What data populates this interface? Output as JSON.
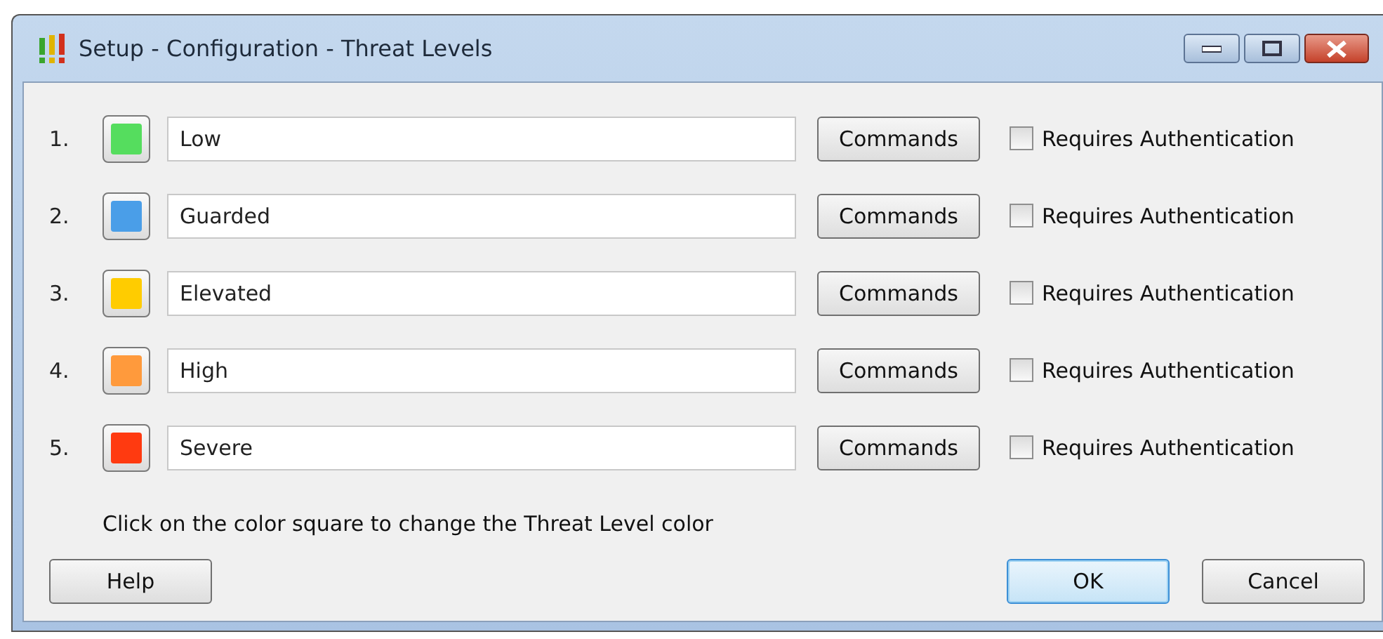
{
  "window": {
    "title": "Setup - Configuration - Threat Levels"
  },
  "levels": [
    {
      "number": "1.",
      "color": "#55dd5e",
      "name": "Low",
      "button": "Commands",
      "auth_label": "Requires Authentication",
      "requires_auth": false
    },
    {
      "number": "2.",
      "color": "#4a9ee8",
      "name": "Guarded",
      "button": "Commands",
      "auth_label": "Requires Authentication",
      "requires_auth": false
    },
    {
      "number": "3.",
      "color": "#ffcc00",
      "name": "Elevated",
      "button": "Commands",
      "auth_label": "Requires Authentication",
      "requires_auth": false
    },
    {
      "number": "4.",
      "color": "#ff9a3c",
      "name": "High",
      "button": "Commands",
      "auth_label": "Requires Authentication",
      "requires_auth": false
    },
    {
      "number": "5.",
      "color": "#ff3a10",
      "name": "Severe",
      "button": "Commands",
      "auth_label": "Requires Authentication",
      "requires_auth": false
    }
  ],
  "hint": "Click on the color square to change the Threat Level color",
  "buttons": [
    {
      "label": "Help",
      "focused": false
    },
    {
      "label": "OK",
      "focused": true
    },
    {
      "label": "Cancel",
      "focused": false
    }
  ]
}
